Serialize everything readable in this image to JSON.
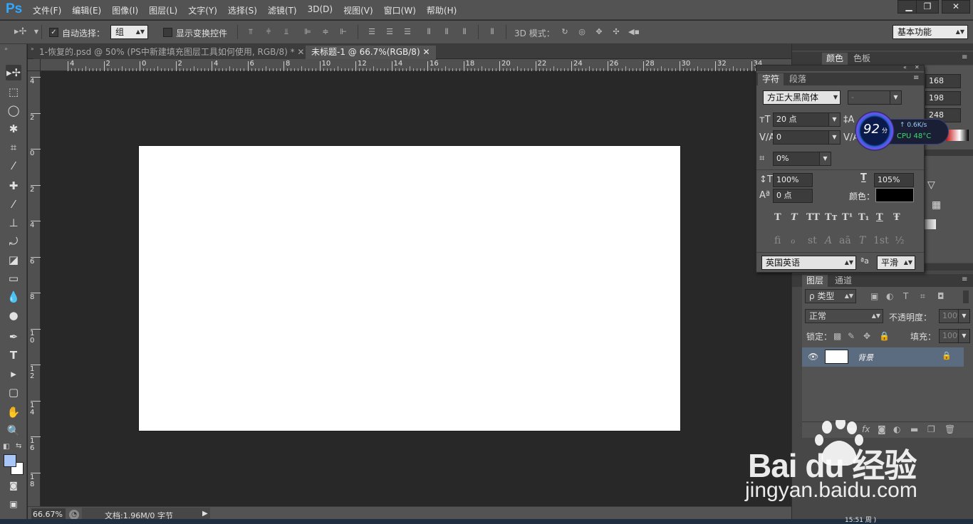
{
  "app": {
    "logo": "Ps",
    "menu": [
      "文件(F)",
      "编辑(E)",
      "图像(I)",
      "图层(L)",
      "文字(Y)",
      "选择(S)",
      "滤镜(T)",
      "3D(D)",
      "视图(V)",
      "窗口(W)",
      "帮助(H)"
    ],
    "window_buttons": [
      "▁",
      "❐",
      "✕"
    ]
  },
  "options": {
    "auto_select_label": "自动选择：",
    "auto_select_value": "组",
    "show_transform_label": "显示变换控件",
    "mode_3d_label": "3D 模式：",
    "workspace": "基本功能"
  },
  "tabs": [
    {
      "label": "1-恢复的.psd @ 50% (PS中新建填充图层工具如何使用, RGB/8) *",
      "active": false
    },
    {
      "label": "未标题-1 @ 66.7%(RGB/8)",
      "active": true
    }
  ],
  "rulers": {
    "h_ticks": [
      "4",
      "2",
      "0",
      "2",
      "4",
      "6",
      "8",
      "10",
      "12",
      "14",
      "16",
      "18",
      "20",
      "22",
      "24",
      "26",
      "28",
      "30",
      "32",
      "34"
    ],
    "v_ticks": [
      "4",
      "2",
      "0",
      "2",
      "4",
      "6",
      "8",
      "10",
      "12",
      "14",
      "16",
      "18"
    ]
  },
  "status": {
    "zoom": "66.67%",
    "doc_info": "文档:1.96M/0 字节"
  },
  "color_panel": {
    "tabs": [
      "颜色",
      "色板"
    ],
    "values": [
      "168",
      "198",
      "248"
    ]
  },
  "character_panel": {
    "tabs": [
      "字符",
      "段落"
    ],
    "font_family": "方正大黑简体",
    "font_style": "-",
    "font_size": "20 点",
    "kerning": "0",
    "tracking": "0%",
    "vertical_scale": "100%",
    "horizontal_scale": "105%",
    "baseline_shift": "0 点",
    "color_label": "颜色：",
    "text_color": "#000000",
    "style_buttons": [
      "T",
      "T",
      "TT",
      "Tт",
      "T¹",
      "T₁",
      "T",
      "Ŧ"
    ],
    "opentype_buttons": [
      "fi",
      "ℴ",
      "st",
      "A",
      "aā",
      "T",
      "1st",
      "½"
    ],
    "language": "英国英语",
    "aa_label": "ªa",
    "antialias": "平滑"
  },
  "layers_panel": {
    "tabs": [
      "图层",
      "通道"
    ],
    "filter_label": "ρ 类型",
    "blend_mode": "正常",
    "opacity_label": "不透明度：",
    "opacity_value": "100%",
    "lock_label": "锁定：",
    "fill_label": "填充：",
    "fill_value": "100%",
    "layers": [
      {
        "name": "背景",
        "visible": true,
        "locked": true
      }
    ]
  },
  "cpu_widget": {
    "score": "92",
    "score_unit": "分",
    "net": "↑ 0.6K/s",
    "cpu": "CPU 48°C"
  },
  "taskbar": {
    "clock_partial": "15:51 周 )"
  },
  "watermark": {
    "brand": "Bai du 经验",
    "url": "jingyan.baidu.com"
  }
}
